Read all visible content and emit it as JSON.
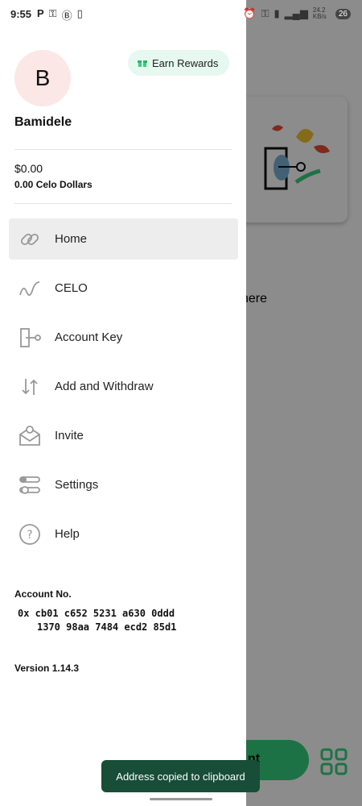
{
  "status_bar": {
    "time": "9:55",
    "battery": "26",
    "right_icons_text": "24.2 KB/s"
  },
  "background": {
    "partial_text": "here",
    "partial_button_label": "nt"
  },
  "drawer": {
    "avatar_initial": "B",
    "user_name": "Bamidele",
    "rewards_label": "Earn Rewards",
    "balance": "$0.00",
    "balance_sub": "0.00 Celo Dollars",
    "menu": [
      {
        "label": "Home",
        "icon": "link-icon",
        "active": true
      },
      {
        "label": "CELO",
        "icon": "wave-icon",
        "active": false
      },
      {
        "label": "Account Key",
        "icon": "key-icon",
        "active": false
      },
      {
        "label": "Add and Withdraw",
        "icon": "arrows-updown-icon",
        "active": false
      },
      {
        "label": "Invite",
        "icon": "envelope-icon",
        "active": false
      },
      {
        "label": "Settings",
        "icon": "sliders-icon",
        "active": false
      },
      {
        "label": "Help",
        "icon": "help-icon",
        "active": false
      }
    ],
    "account_label": "Account No.",
    "account_line1": "0x  cb01  c652  5231  a630  0ddd",
    "account_line2": "1370  98aa  7484  ecd2  85d1",
    "version": "Version 1.14.3"
  },
  "toast": {
    "message": "Address copied to clipboard"
  },
  "colors": {
    "accent_green": "#35d07f",
    "toast_bg": "#184d37",
    "rewards_bg": "#e6f8ef",
    "avatar_bg": "#fbe7e5"
  }
}
